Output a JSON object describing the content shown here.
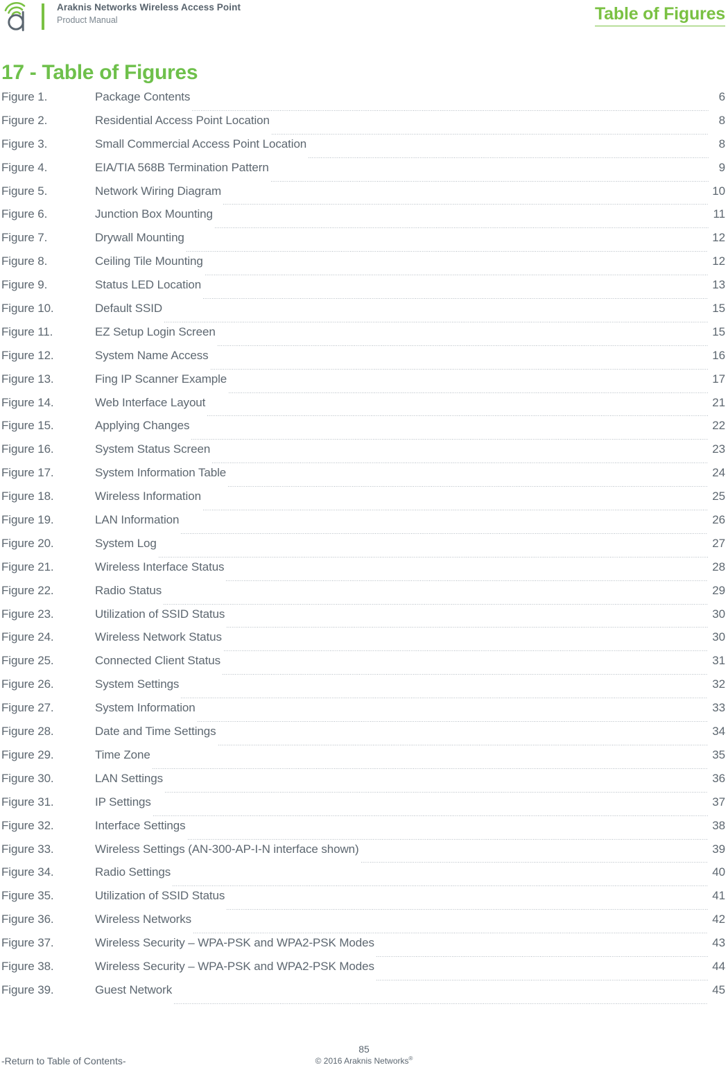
{
  "colors": {
    "brand_green": "#7ac143",
    "title_green": "#6ec04b",
    "body_gray": "#5b6670",
    "leader_gray": "#a9b2ba"
  },
  "header": {
    "logo_icon": "araknis-a-wifi-logo",
    "product_title": "Araknis Networks Wireless Access Point",
    "product_subtitle": "Product Manual",
    "section_link": "Table of Figures"
  },
  "title": "17 - Table of Figures",
  "figures": {
    "columns": [
      "label",
      "title",
      "page"
    ],
    "rows": [
      {
        "label": "Figure 1.",
        "title": "Package Contents",
        "page": "6"
      },
      {
        "label": "Figure 2.",
        "title": "Residential Access Point Location",
        "page": "8"
      },
      {
        "label": "Figure 3.",
        "title": "Small Commercial Access Point Location",
        "page": "8"
      },
      {
        "label": "Figure 4.",
        "title": "EIA/TIA 568B Termination Pattern",
        "page": "9"
      },
      {
        "label": "Figure 5.",
        "title": "Network Wiring Diagram",
        "page": "10"
      },
      {
        "label": "Figure 6.",
        "title": "Junction Box Mounting",
        "page": "11"
      },
      {
        "label": "Figure 7.",
        "title": "Drywall Mounting",
        "page": "12"
      },
      {
        "label": "Figure 8.",
        "title": "Ceiling Tile Mounting",
        "page": "12"
      },
      {
        "label": "Figure 9.",
        "title": "Status LED Location",
        "page": "13"
      },
      {
        "label": "Figure 10.",
        "title": "Default SSID",
        "page": "15"
      },
      {
        "label": "Figure 11.",
        "title": "EZ Setup Login Screen",
        "page": "15"
      },
      {
        "label": "Figure 12.",
        "title": "System Name Access",
        "page": "16"
      },
      {
        "label": "Figure 13.",
        "title": "Fing IP Scanner Example",
        "page": "17"
      },
      {
        "label": "Figure 14.",
        "title": "Web Interface Layout",
        "page": "21"
      },
      {
        "label": "Figure 15.",
        "title": "Applying Changes",
        "page": "22"
      },
      {
        "label": "Figure 16.",
        "title": "System Status Screen",
        "page": "23"
      },
      {
        "label": "Figure 17.",
        "title": "System Information Table",
        "page": "24"
      },
      {
        "label": "Figure 18.",
        "title": "Wireless Information",
        "page": "25"
      },
      {
        "label": "Figure 19.",
        "title": "LAN Information",
        "page": "26"
      },
      {
        "label": "Figure 20.",
        "title": "System Log",
        "page": "27"
      },
      {
        "label": "Figure 21.",
        "title": "Wireless Interface Status",
        "page": "28"
      },
      {
        "label": "Figure 22.",
        "title": "Radio Status",
        "page": "29"
      },
      {
        "label": "Figure 23.",
        "title": "Utilization of SSID Status",
        "page": "30"
      },
      {
        "label": "Figure 24.",
        "title": "Wireless Network Status",
        "page": "30"
      },
      {
        "label": "Figure 25.",
        "title": "Connected Client Status",
        "page": "31"
      },
      {
        "label": "Figure 26.",
        "title": "System Settings",
        "page": "32"
      },
      {
        "label": "Figure 27.",
        "title": "System Information",
        "page": "33"
      },
      {
        "label": "Figure 28.",
        "title": "Date and Time Settings",
        "page": "34"
      },
      {
        "label": "Figure 29.",
        "title": "Time Zone",
        "page": "35"
      },
      {
        "label": "Figure 30.",
        "title": "LAN Settings",
        "page": "36"
      },
      {
        "label": "Figure 31.",
        "title": "IP Settings",
        "page": "37"
      },
      {
        "label": "Figure 32.",
        "title": "Interface Settings",
        "page": "38"
      },
      {
        "label": "Figure 33.",
        "title": "Wireless Settings (AN-300-AP-I-N interface shown)",
        "page": "39"
      },
      {
        "label": "Figure 34.",
        "title": "Radio Settings",
        "page": "40"
      },
      {
        "label": "Figure 35.",
        "title": "Utilization of SSID Status",
        "page": "41"
      },
      {
        "label": "Figure 36.",
        "title": "Wireless Networks",
        "page": "42"
      },
      {
        "label": "Figure 37.",
        "title": "Wireless Security – WPA-PSK and WPA2-PSK Modes",
        "page": "43"
      },
      {
        "label": "Figure 38.",
        "title": "Wireless Security – WPA-PSK and WPA2-PSK Modes",
        "page": "44"
      },
      {
        "label": "Figure 39.",
        "title": "Guest Network",
        "page": "45"
      }
    ]
  },
  "footer": {
    "page_number": "85",
    "return_link": "-Return to Table of Contents-",
    "copyright": "© 2016 Araknis Networks",
    "copyright_mark": "®"
  }
}
